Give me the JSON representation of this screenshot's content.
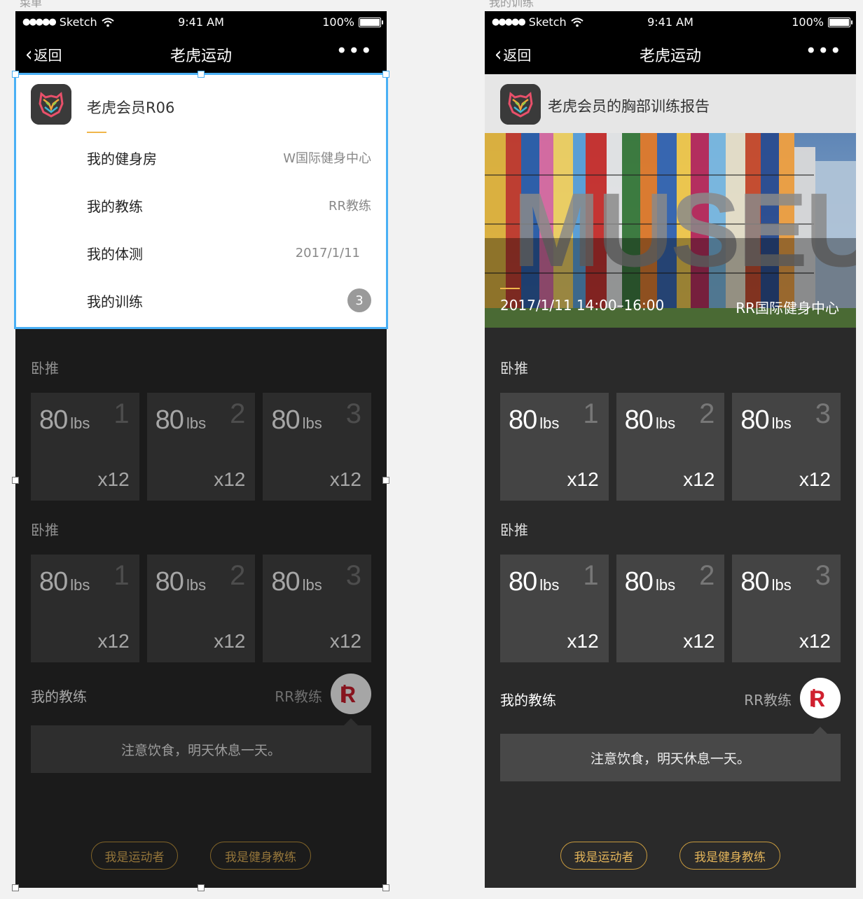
{
  "artboards": {
    "left_label": "菜单",
    "right_label": "我的训练"
  },
  "status_bar": {
    "carrier": "Sketch",
    "time": "9:41 AM",
    "battery": "100%"
  },
  "nav": {
    "back": "返回",
    "title": "老虎运动",
    "more": "•••"
  },
  "menu_card": {
    "name": "老虎会员R06",
    "rows": [
      {
        "label": "我的健身房",
        "value": "W国际健身中心"
      },
      {
        "label": "我的教练",
        "value": "RR教练"
      },
      {
        "label": "我的体测",
        "value": "2017/1/11"
      },
      {
        "label": "我的训练",
        "badge": "3"
      }
    ]
  },
  "report": {
    "title": "老虎会员的胸部训练报告",
    "date": "2017/1/11 14:00–16:00",
    "venue": "RR国际健身中心",
    "image_text": "MUSEUM"
  },
  "workout": {
    "exercises": [
      {
        "name": "卧推",
        "sets": [
          {
            "weight": "80",
            "unit": "lbs",
            "index": "1",
            "reps": "x12"
          },
          {
            "weight": "80",
            "unit": "lbs",
            "index": "2",
            "reps": "x12"
          },
          {
            "weight": "80",
            "unit": "lbs",
            "index": "3",
            "reps": "x12"
          }
        ]
      },
      {
        "name": "卧推",
        "sets": [
          {
            "weight": "80",
            "unit": "lbs",
            "index": "1",
            "reps": "x12"
          },
          {
            "weight": "80",
            "unit": "lbs",
            "index": "2",
            "reps": "x12"
          },
          {
            "weight": "80",
            "unit": "lbs",
            "index": "3",
            "reps": "x12"
          }
        ]
      }
    ]
  },
  "coach": {
    "label": "我的教练",
    "name": "RR教练",
    "note": "注意饮食，明天休息一天。"
  },
  "role_buttons": {
    "athlete": "我是运动者",
    "coach": "我是健身教练"
  },
  "colors": {
    "accent_gold": "#f0b64a",
    "selection_blue": "#4ab0f5",
    "coach_logo_red": "#d0202f"
  }
}
